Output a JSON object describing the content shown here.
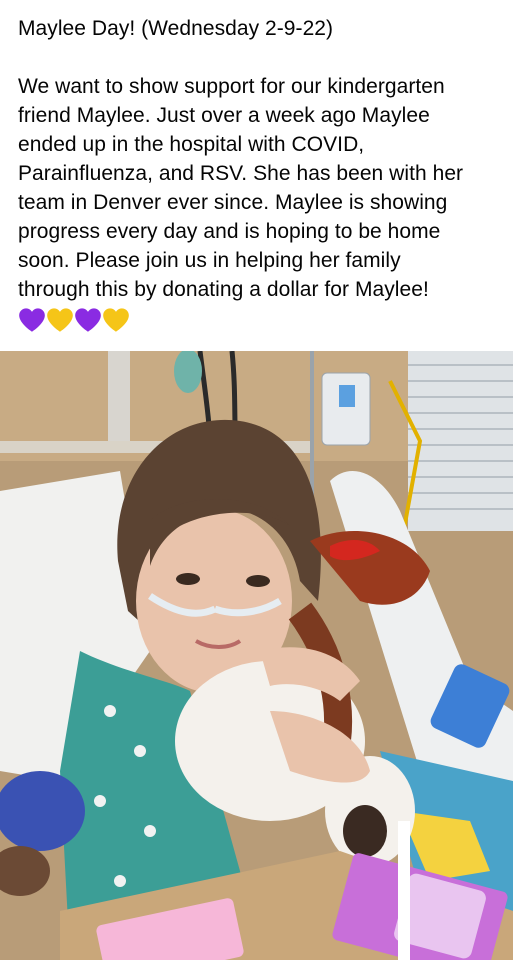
{
  "post": {
    "title_line": "Maylee Day! (Wednesday 2-9-22)",
    "body_lines": [
      "We want to show support for our kindergarten",
      "friend Maylee. Just over a week ago Maylee",
      "ended up in the hospital with COVID,",
      "Parainfluenza, and RSV. She has been with her",
      "team in Denver ever since. Maylee is showing",
      "progress every day and is hoping to be home",
      "soon. Please join us in helping her family",
      "through this by donating a dollar for Maylee!"
    ],
    "hearts": [
      {
        "icon": "purple-heart-icon",
        "color": "#8a2be2"
      },
      {
        "icon": "yellow-heart-icon",
        "color": "#f5c518"
      },
      {
        "icon": "purple-heart-icon",
        "color": "#8a2be2"
      },
      {
        "icon": "yellow-heart-icon",
        "color": "#f5c518"
      }
    ]
  },
  "photo": {
    "subject": "hospital-photo"
  }
}
